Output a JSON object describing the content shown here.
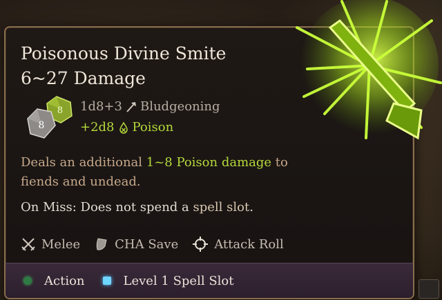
{
  "tooltip": {
    "title_line1": "Poisonous Divine Smite",
    "title_line2": "6~27 Damage",
    "dice": {
      "d8_front": "8",
      "d8_back": "8"
    },
    "damage": [
      {
        "formula": "1d8+3",
        "type": "Bludgeoning",
        "color": "#b7aea3",
        "icon": "mace-icon"
      },
      {
        "formula": "+2d8",
        "type": "Poison",
        "color": "#b5d93c",
        "icon": "poison-drop-icon"
      }
    ],
    "description": {
      "before": "Deals an additional ",
      "highlight": "1~8 Poison damage",
      "after": " to fiends and undead."
    },
    "on_miss": {
      "before": "On Miss: Does not spend a ",
      "highlight": "spell slot",
      "after": "."
    },
    "properties": [
      {
        "label": "Melee",
        "icon": "crossed-swords-icon"
      },
      {
        "label": "CHA Save",
        "icon": "shield-icon"
      },
      {
        "label": "Attack Roll",
        "icon": "crosshair-icon"
      }
    ],
    "footer": {
      "action": "Action",
      "slot": "Level 1 Spell Slot"
    }
  },
  "colors": {
    "poison_green": "#b5d93c",
    "border_gold": "#8a6e4e",
    "footer_purple": "#3a2a3a",
    "slot_blue": "#6fd6ff",
    "action_green": "#2f7a44"
  }
}
